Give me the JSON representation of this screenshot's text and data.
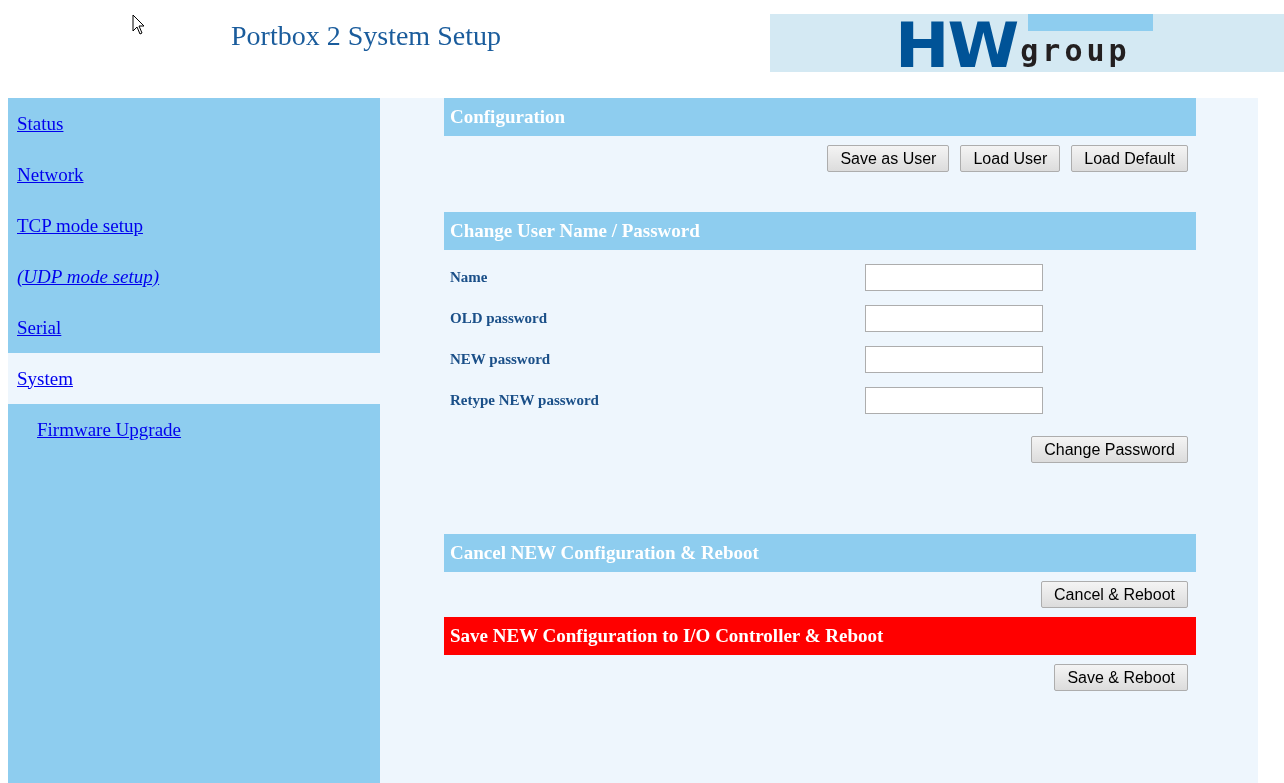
{
  "header": {
    "title": "Portbox 2 System Setup",
    "logo": {
      "mark": "HW",
      "word": "group"
    }
  },
  "sidebar": {
    "items": [
      {
        "label": "Status",
        "selected": false,
        "italic": false
      },
      {
        "label": "Network",
        "selected": false,
        "italic": false
      },
      {
        "label": "TCP mode setup",
        "selected": false,
        "italic": false
      },
      {
        "label": "(UDP mode setup)",
        "selected": false,
        "italic": true
      },
      {
        "label": "Serial",
        "selected": false,
        "italic": false
      },
      {
        "label": "System",
        "selected": true,
        "italic": false,
        "children": [
          {
            "label": "Firmware Upgrade",
            "selected": false,
            "italic": false
          }
        ]
      }
    ]
  },
  "sections": [
    {
      "title": "Configuration",
      "kind": "normal",
      "buttons": [
        "Save as User",
        "Load User",
        "Load Default"
      ]
    },
    {
      "title": "Change User Name / Password",
      "kind": "normal",
      "fields": [
        {
          "label": "Name"
        },
        {
          "label": "OLD password"
        },
        {
          "label": "NEW password"
        },
        {
          "label": "Retype NEW password"
        }
      ],
      "buttons": [
        "Change Password"
      ]
    },
    {
      "title": "Cancel NEW Configuration & Reboot",
      "kind": "normal",
      "buttons": [
        "Cancel & Reboot"
      ]
    },
    {
      "title": "Save NEW Configuration to I/O Controller & Reboot",
      "kind": "alert",
      "buttons": [
        "Save & Reboot"
      ]
    }
  ]
}
